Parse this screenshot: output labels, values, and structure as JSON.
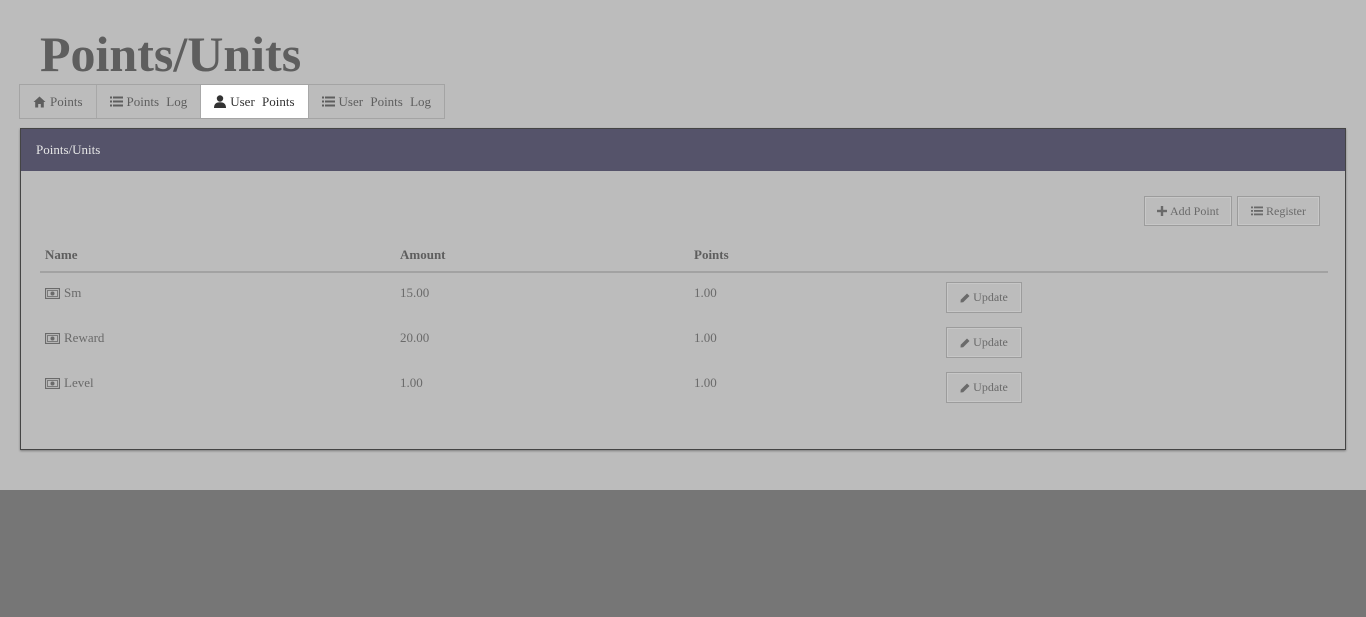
{
  "page": {
    "title": "Points/Units"
  },
  "tabs": [
    {
      "label": "Points",
      "icon": "home-icon",
      "active": false
    },
    {
      "label": "Points Log",
      "icon": "list-icon",
      "active": false
    },
    {
      "label": "User Points",
      "icon": "user-icon",
      "active": true
    },
    {
      "label": "User Points Log",
      "icon": "list-icon",
      "active": false
    }
  ],
  "panel": {
    "heading": "Points/Units",
    "actions": {
      "add_label": "Add Point",
      "register_label": "Register"
    },
    "table": {
      "columns": [
        "Name",
        "Amount",
        "Points"
      ],
      "rows": [
        {
          "name": "Sm",
          "amount": "15.00",
          "points": "1.00",
          "action": "Update"
        },
        {
          "name": "Reward",
          "amount": "20.00",
          "points": "1.00",
          "action": "Update"
        },
        {
          "name": "Level",
          "amount": "1.00",
          "points": "1.00",
          "action": "Update"
        }
      ]
    }
  },
  "colors": {
    "panel_heading_bg": "#55536a",
    "page_bg": "#bcbcbc",
    "footer_bg": "#767676",
    "active_tab_bg": "#ffffff"
  }
}
